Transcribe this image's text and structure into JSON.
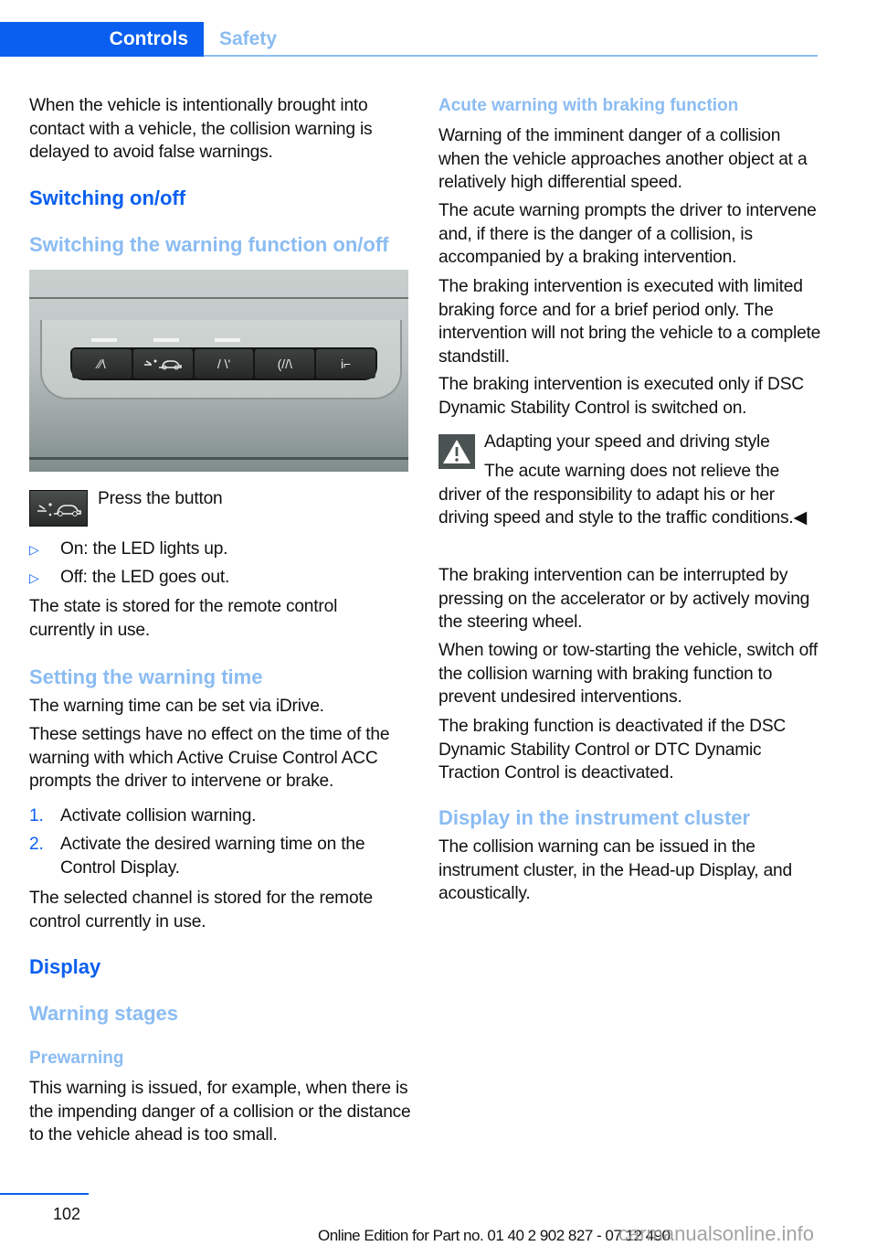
{
  "header": {
    "active_tab": "Controls",
    "inactive_tab": "Safety"
  },
  "left": {
    "intro": "When the vehicle is intentionally brought into contact with a vehicle, the collision warning is delayed to avoid false warnings.",
    "h_switching": "Switching on/off",
    "h_switching_warning": "Switching the warning function on/off",
    "photo_alt": "Button panel with driver assistance buttons",
    "press_button": "Press the button",
    "bullets": [
      "On: the LED lights up.",
      "Off: the LED goes out."
    ],
    "state_stored": "The state is stored for the remote control currently in use.",
    "h_warning_time": "Setting the warning time",
    "warning_time_text": "The warning time can be set via iDrive.",
    "settings_effect": "These settings have no effect on the time of the warning with which Active Cruise Control ACC prompts the driver to intervene or brake.",
    "steps": [
      {
        "num": "1.",
        "text": "Activate collision warning."
      },
      {
        "num": "2.",
        "text": "Activate the desired warning time on the Control Display."
      }
    ],
    "channel_stored": "The selected channel is stored for the remote control currently in use.",
    "h_display": "Display",
    "h_warning_stages": "Warning stages",
    "h_prewarning": "Prewarning",
    "prewarning_text": "This warning is issued, for example, when there is the impending danger of a collision or the distance to the vehicle ahead is too small."
  },
  "right": {
    "h_acute": "Acute warning with braking function",
    "acute_1": "Warning of the imminent danger of a collision when the vehicle approaches another object at a relatively high differential speed.",
    "acute_2": "The acute warning prompts the driver to intervene and, if there is the danger of a collision, is accompanied by a braking intervention.",
    "acute_3": "The braking intervention is executed with limited braking force and for a brief period only. The intervention will not bring the vehicle to a complete standstill.",
    "acute_4": "The braking intervention is executed only if DSC Dynamic Stability Control is switched on.",
    "warning_title": "Adapting your speed and driving style",
    "warning_body": "The acute warning does not relieve the driver of the responsibility to adapt his or her driving speed and style to the traffic conditions.◀",
    "interrupt": "The braking intervention can be interrupted by pressing on the accelerator or by actively moving the steering wheel.",
    "towing": "When towing or tow-starting the vehicle, switch off the collision warning with braking function to prevent undesired interventions.",
    "deactivated": "The braking function is deactivated if the DSC Dynamic Stability Control or DTC Dynamic Traction Control is deactivated.",
    "h_instrument": "Display in the instrument cluster",
    "instrument_text": "The collision warning can be issued in the instrument cluster, in the Head-up Display, and acoustically."
  },
  "footer": {
    "page_number": "102",
    "edition": "Online Edition for Part no. 01 40 2 902 827 - 07 12 490",
    "watermark": "carmanualsonline.info"
  },
  "colors": {
    "brand_blue": "#0a5ff0",
    "light_blue": "#8bbcf2"
  }
}
